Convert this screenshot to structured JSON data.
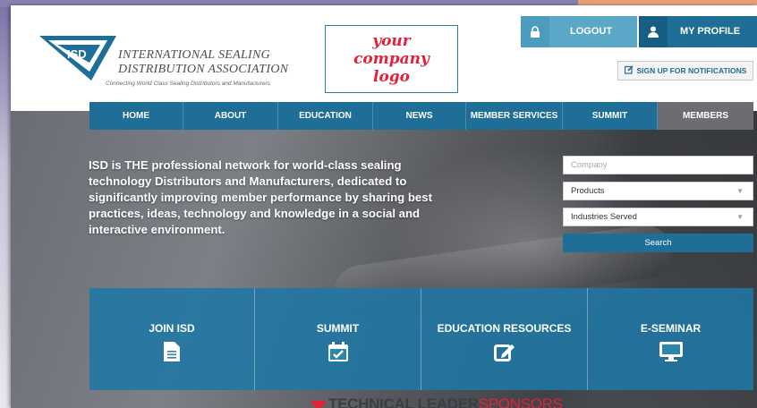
{
  "header": {
    "logo": {
      "abbr": "ISD",
      "line1": "INTERNATIONAL SEALING",
      "line2": "DISTRIBUTION ASSOCIATION",
      "tagline": "Connecting World Class Sealing Distributors and Manufacturers"
    },
    "company_logo": "your company logo",
    "logout_label": "LOGOUT",
    "profile_label": "MY PROFILE",
    "signup_label": "SIGN UP FOR NOTIFICATIONS"
  },
  "nav": {
    "items": [
      {
        "label": "HOME"
      },
      {
        "label": "ABOUT"
      },
      {
        "label": "EDUCATION"
      },
      {
        "label": "NEWS"
      },
      {
        "label": "MEMBER SERVICES"
      },
      {
        "label": "SUMMIT"
      },
      {
        "label": "MEMBERS"
      }
    ]
  },
  "hero": {
    "intro": "ISD is THE professional network for world-class sealing technology Distributors and Manufacturers, dedicated to significantly improving member performance by sharing best practices, ideas, technology and knowledge in a social and interactive environment."
  },
  "search": {
    "company_placeholder": "Company",
    "products_value": "Products",
    "industries_value": "Industries Served",
    "button_label": "Search"
  },
  "tiles": [
    {
      "label": "JOIN ISD",
      "icon": "document-icon"
    },
    {
      "label": "SUMMIT",
      "icon": "calendar-check-icon"
    },
    {
      "label": "EDUCATION RESOURCES",
      "icon": "edit-icon"
    },
    {
      "label": "E-SEMINAR",
      "icon": "monitor-icon"
    }
  ],
  "sponsors": {
    "part1": "TECHNICAL LEADER",
    "part2": "SPONSORS"
  },
  "colors": {
    "primary": "#1f6e97",
    "light_blue": "#5aa7c8",
    "members_gray": "#6b6d70",
    "accent_red": "#e2213b"
  }
}
